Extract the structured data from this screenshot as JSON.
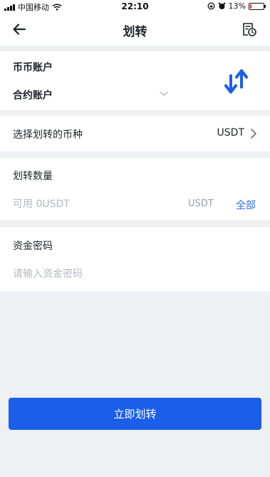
{
  "status_bar": {
    "carrier": "中国移动",
    "time": "22:10",
    "battery": "13%",
    "battery_level": 0.13
  },
  "nav": {
    "title": "划转",
    "back_icon": "arrow-left-icon",
    "record_icon": "transfer-record-icon"
  },
  "accounts": {
    "from_label": "币币账户",
    "to_label": "合约账户",
    "swap_icon": "swap-arrows-icon",
    "swap_color": "#1b5eea"
  },
  "coin": {
    "label": "选择划转的币种",
    "value": "USDT"
  },
  "amount": {
    "label": "划转数量",
    "placeholder": "可用 0USDT",
    "unit": "USDT",
    "all_label": "全部"
  },
  "password": {
    "label": "资金密码",
    "placeholder": "请输入资金密码"
  },
  "submit": {
    "label": "立即划转",
    "color": "#1b5eea"
  }
}
